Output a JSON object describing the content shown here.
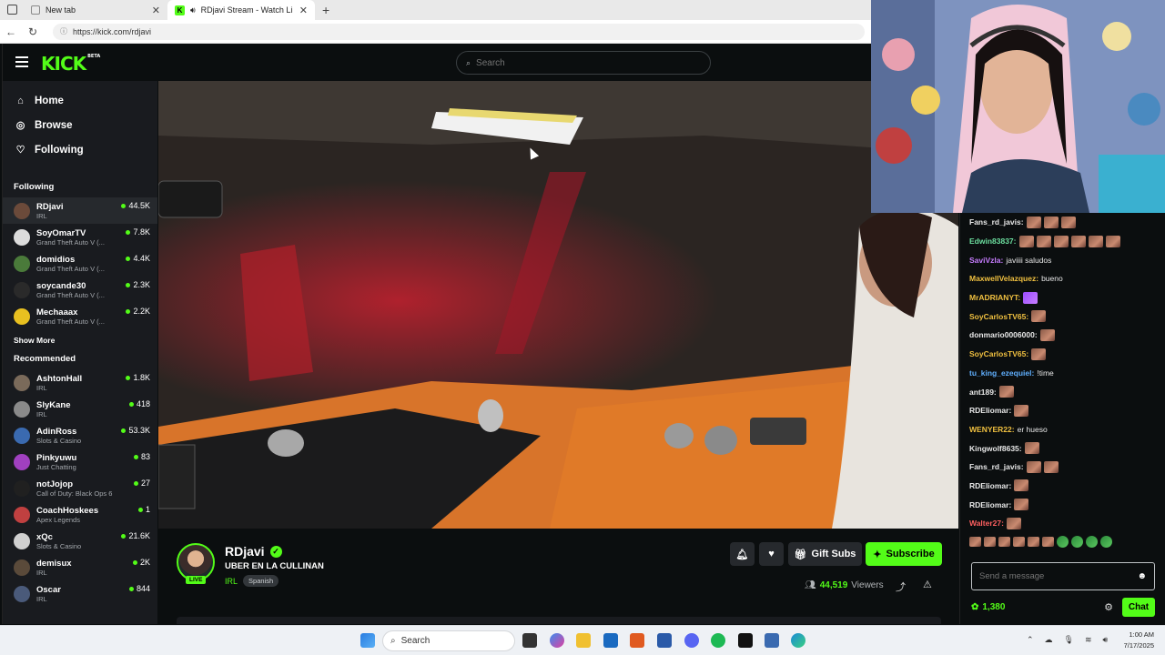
{
  "browser": {
    "tabs": [
      {
        "label": "New tab"
      },
      {
        "label": "RDjavi Stream - Watch Live o"
      }
    ],
    "url": "https://kick.com/rdjavi"
  },
  "header": {
    "logo": "KICK",
    "logo_badge": "BETA",
    "search_placeholder": "Search"
  },
  "sidebar": {
    "nav": [
      {
        "label": "Home",
        "icon": "home-icon"
      },
      {
        "label": "Browse",
        "icon": "compass-icon"
      },
      {
        "label": "Following",
        "icon": "heart-icon"
      }
    ],
    "following_title": "Following",
    "following": [
      {
        "name": "RDjavi",
        "category": "IRL",
        "viewers": "44.5K",
        "color": "#6b4a3a"
      },
      {
        "name": "SoyOmarTV",
        "category": "Grand Theft Auto V (...",
        "viewers": "7.8K",
        "color": "#dcdcdc"
      },
      {
        "name": "domidios",
        "category": "Grand Theft Auto V (...",
        "viewers": "4.4K",
        "color": "#4a7a3a"
      },
      {
        "name": "soycande30",
        "category": "Grand Theft Auto V (...",
        "viewers": "2.3K",
        "color": "#2a2a2a"
      },
      {
        "name": "Mechaaax",
        "category": "Grand Theft Auto V (...",
        "viewers": "2.2K",
        "color": "#e8c020"
      }
    ],
    "show_more": "Show More",
    "recommended_title": "Recommended",
    "recommended": [
      {
        "name": "AshtonHall",
        "category": "IRL",
        "viewers": "1.8K",
        "color": "#7a6a5a"
      },
      {
        "name": "SlyKane",
        "category": "IRL",
        "viewers": "418",
        "color": "#8a8a8a"
      },
      {
        "name": "AdinRoss",
        "category": "Slots & Casino",
        "viewers": "53.3K",
        "color": "#3a6ab0"
      },
      {
        "name": "Pinkyuwu",
        "category": "Just Chatting",
        "viewers": "83",
        "color": "#a040c0"
      },
      {
        "name": "notJojop",
        "category": "Call of Duty: Black Ops 6",
        "viewers": "27",
        "color": "#202020"
      },
      {
        "name": "CoachHoskees",
        "category": "Apex Legends",
        "viewers": "1",
        "color": "#c04040"
      },
      {
        "name": "xQc",
        "category": "Slots & Casino",
        "viewers": "21.6K",
        "color": "#d0d0d0"
      },
      {
        "name": "demisux",
        "category": "IRL",
        "viewers": "2K",
        "color": "#5a4a3a"
      },
      {
        "name": "Oscar",
        "category": "IRL",
        "viewers": "844",
        "color": "#4a5a7a"
      }
    ]
  },
  "stream": {
    "channel": "RDjavi",
    "live_label": "LIVE",
    "title": "UBER EN LA CULLINAN",
    "category": "IRL",
    "language": "Spanish",
    "gift_label": "Gift Subs",
    "subscribe_label": "Subscribe",
    "viewers": "44,519",
    "viewers_label": "Viewers"
  },
  "chat": {
    "messages": [
      {
        "user": "Fans_rd_javis:",
        "color": "#e8e8e8",
        "text": "",
        "emotes": 3
      },
      {
        "user": "Edwin83837:",
        "color": "#6de0a0",
        "text": "",
        "emotes": 6
      },
      {
        "user": "SaviVzla:",
        "color": "#c77dff",
        "text": "javiiii saludos",
        "emotes": 0
      },
      {
        "user": "MaxwellVelazquez:",
        "color": "#f0c040",
        "text": "bueno",
        "emotes": 0
      },
      {
        "user": "MrADRIANYT:",
        "color": "#f0c040",
        "text": "",
        "emotes": 1
      },
      {
        "user": "SoyCarlosTV65:",
        "color": "#f0c040",
        "text": "",
        "emotes": 1
      },
      {
        "user": "donmario0006000:",
        "color": "#e8e8e8",
        "text": "",
        "emotes": 1
      },
      {
        "user": "SoyCarlosTV65:",
        "color": "#f0c040",
        "text": "",
        "emotes": 1
      },
      {
        "user": "tu_king_ezequiel:",
        "color": "#60b0ff",
        "text": "!time",
        "emotes": 0
      },
      {
        "user": "ant189:",
        "color": "#e8e8e8",
        "text": "",
        "emotes": 1
      },
      {
        "user": "RDEliomar:",
        "color": "#e8e8e8",
        "text": "",
        "emotes": 1
      },
      {
        "user": "WENYER22:",
        "color": "#f0c040",
        "text": "er hueso",
        "emotes": 0
      },
      {
        "user": "Kingwolf8635:",
        "color": "#e8e8e8",
        "text": "",
        "emotes": 1
      },
      {
        "user": "Fans_rd_javis:",
        "color": "#e8e8e8",
        "text": "",
        "emotes": 2
      },
      {
        "user": "RDEliomar:",
        "color": "#e8e8e8",
        "text": "",
        "emotes": 1
      },
      {
        "user": "RDEliomar:",
        "color": "#e8e8e8",
        "text": "",
        "emotes": 1
      },
      {
        "user": "Walter27:",
        "color": "#ff6060",
        "text": "",
        "emotes": 1
      }
    ],
    "input_placeholder": "Send a message",
    "points": "1,380",
    "send_label": "Chat"
  },
  "taskbar": {
    "search_placeholder": "Search",
    "time": "1:00 AM",
    "date": "7/17/2025"
  },
  "colors": {
    "accent": "#53fc18",
    "background": "#0b0e0f",
    "sidebar": "#191b1f"
  }
}
